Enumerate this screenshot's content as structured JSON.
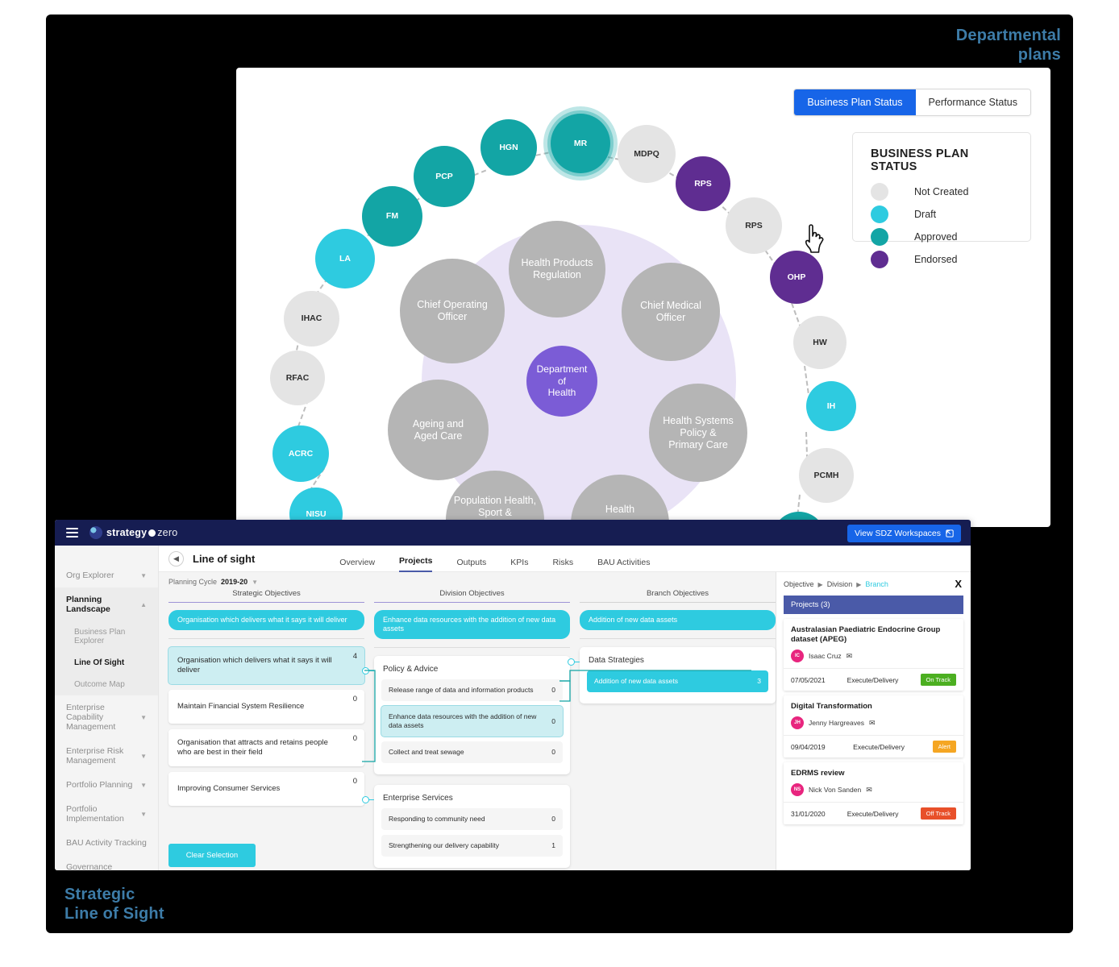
{
  "slide": {
    "label_departmental": "Departmental\nplans",
    "label_departmental_line1": "Departmental",
    "label_departmental_line2": "plans",
    "label_strategic_line1": "Strategic",
    "label_strategic_line2": "Line of Sight",
    "accent_color": "#3d7ca8"
  },
  "explorer": {
    "toggle": {
      "business_plan_status": "Business Plan Status",
      "performance_status": "Performance Status",
      "active": "Business Plan Status",
      "active_color": "#1765e8"
    },
    "legend": {
      "title": "BUSINESS PLAN STATUS",
      "items": [
        {
          "label": "Not Created",
          "color": "#e4e4e4"
        },
        {
          "label": "Draft",
          "color": "#2ecbe0"
        },
        {
          "label": "Approved",
          "color": "#13a5a5"
        },
        {
          "label": "Endorsed",
          "color": "#5f2d91"
        }
      ]
    },
    "center_node": {
      "label": "Department\nof\nHealth",
      "color": "#7b5cd6"
    },
    "divisions": [
      {
        "label": "Health Products\nRegulation",
        "color": "#b5b5b5"
      },
      {
        "label": "Chief Operating\nOfficer",
        "color": "#b5b5b5"
      },
      {
        "label": "Chief Medical\nOfficer",
        "color": "#b5b5b5"
      },
      {
        "label": "Ageing and\nAged Care",
        "color": "#b5b5b5"
      },
      {
        "label": "Health Systems\nPolicy &\nPrimary Care",
        "color": "#b5b5b5"
      },
      {
        "label": "Population Health,\nSport &",
        "color": "#b5b5b5"
      },
      {
        "label": "Health",
        "color": "#b5b5b5"
      }
    ],
    "branches": [
      {
        "label": "NISU",
        "status": "Draft"
      },
      {
        "label": "ACRC",
        "status": "Draft"
      },
      {
        "label": "RFAC",
        "status": "Not Created"
      },
      {
        "label": "IHAC",
        "status": "Not Created"
      },
      {
        "label": "LA",
        "status": "Draft"
      },
      {
        "label": "FM",
        "status": "Approved"
      },
      {
        "label": "PCP",
        "status": "Approved"
      },
      {
        "label": "HGN",
        "status": "Approved"
      },
      {
        "label": "MR",
        "status": "Approved",
        "selected": true
      },
      {
        "label": "MDPQ",
        "status": "Not Created"
      },
      {
        "label": "RPS",
        "status": "Endorsed"
      },
      {
        "label": "RPS",
        "status": "Not Created"
      },
      {
        "label": "OHP",
        "status": "Endorsed"
      },
      {
        "label": "HW",
        "status": "Not Created"
      },
      {
        "label": "IH",
        "status": "Draft"
      },
      {
        "label": "PCMH",
        "status": "Not Created"
      },
      {
        "label": "",
        "status": "Approved"
      }
    ]
  },
  "app": {
    "brand": {
      "name": "strategy",
      "suffix": "zero"
    },
    "sdz_button": "View SDZ Workspaces",
    "page_title": "Line of sight",
    "tabs": [
      {
        "label": "Overview",
        "active": false
      },
      {
        "label": "Projects",
        "active": true
      },
      {
        "label": "Outputs",
        "active": false
      },
      {
        "label": "KPIs",
        "active": false
      },
      {
        "label": "Risks",
        "active": false
      },
      {
        "label": "BAU Activities",
        "active": false
      }
    ],
    "sidebar": [
      {
        "label": "Org Explorer",
        "type": "group",
        "expanded": false
      },
      {
        "label": "Planning Landscape",
        "type": "group",
        "expanded": true,
        "selected": true
      },
      {
        "label": "Business Plan Explorer",
        "type": "sub",
        "selected": false
      },
      {
        "label": "Line Of Sight",
        "type": "sub",
        "selected": true
      },
      {
        "label": "Outcome Map",
        "type": "sub",
        "selected": false
      },
      {
        "label": "Enterprise Capability Management",
        "type": "group",
        "expanded": false
      },
      {
        "label": "Enterprise Risk Management",
        "type": "group",
        "expanded": false
      },
      {
        "label": "Portfolio Planning",
        "type": "group",
        "expanded": false
      },
      {
        "label": "Portfolio Implementation",
        "type": "group",
        "expanded": false
      },
      {
        "label": "BAU Activity Tracking",
        "type": "plain"
      },
      {
        "label": "Governance",
        "type": "plain"
      }
    ],
    "planning_cycle": {
      "label": "Planning Cycle",
      "value": "2019-20"
    },
    "clear_selection": "Clear Selection",
    "columns": {
      "strategic": {
        "title": "Strategic Objectives",
        "selected_pill": "Organisation which delivers what it says it will deliver",
        "cards": [
          {
            "text": "Organisation which delivers what it says it will deliver",
            "count": "4",
            "selected": true
          },
          {
            "text": "Maintain Financial System Resilience",
            "count": "0",
            "selected": false
          },
          {
            "text": "Organisation that attracts and retains people who are best in their field",
            "count": "0",
            "selected": false
          },
          {
            "text": "Improving Consumer Services",
            "count": "0",
            "selected": false
          }
        ]
      },
      "division": {
        "title": "Division Objectives",
        "selected_pill": "Enhance data resources with the addition of new data assets",
        "groups": [
          {
            "title": "Policy & Advice",
            "rows": [
              {
                "text": "Release range of data and information products",
                "count": "0",
                "selected": false
              },
              {
                "text": "Enhance data resources with the addition of new data assets",
                "count": "0",
                "selected": true
              },
              {
                "text": "Collect and treat sewage",
                "count": "0",
                "selected": false
              }
            ]
          },
          {
            "title": "Enterprise Services",
            "rows": [
              {
                "text": "Responding to community need",
                "count": "0",
                "selected": false
              },
              {
                "text": "Strengthening our delivery capability",
                "count": "1",
                "selected": false
              }
            ]
          }
        ]
      },
      "branch": {
        "title": "Branch Objectives",
        "selected_pill": "Addition of new data assets",
        "groups": [
          {
            "title": "Data Strategies",
            "rows": [
              {
                "text": "Addition of new data assets",
                "count": "3",
                "highlight": true
              }
            ]
          }
        ]
      }
    },
    "right_panel": {
      "breadcrumb": [
        {
          "label": "Objective",
          "link": false
        },
        {
          "label": "Division",
          "link": false
        },
        {
          "label": "Branch",
          "link": true
        }
      ],
      "close_label": "X",
      "projects_header": "Projects (3)",
      "projects": [
        {
          "name": "Australasian Paediatric Endocrine Group dataset (APEG)",
          "owner": "Isaac Cruz",
          "initials": "IC",
          "date": "07/05/2021",
          "stage": "Execute/Delivery",
          "status": "On Track",
          "status_color": "#4caf21"
        },
        {
          "name": "Digital Transformation",
          "owner": "Jenny Hargreaves",
          "initials": "JH",
          "date": "09/04/2019",
          "stage": "Execute/Delivery",
          "status": "Alert",
          "status_color": "#f5a623"
        },
        {
          "name": "EDRMS review",
          "owner": "Nick Von Sanden",
          "initials": "NS",
          "date": "31/01/2020",
          "stage": "Execute/Delivery",
          "status": "Off Track",
          "status_color": "#e8502a"
        }
      ]
    }
  }
}
